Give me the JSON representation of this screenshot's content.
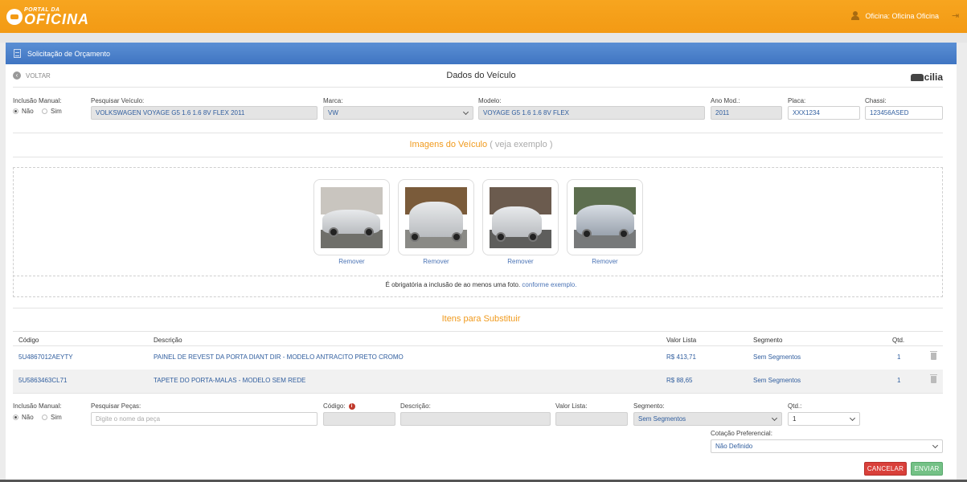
{
  "header": {
    "logo_top": "PORTAL DA",
    "logo_bottom": "OFICINA",
    "user_label": "Oficina: Oficina Oficina"
  },
  "panel": {
    "title": "Solicitação de Orçamento",
    "back_label": "VOLTAR",
    "section_title": "Dados do Veículo",
    "brand_logo": "cilia"
  },
  "vehicle": {
    "manual_label": "Inclusão Manual:",
    "radio_no": "Não",
    "radio_yes": "Sim",
    "search_label": "Pesquisar Veículo:",
    "search_value": "VOLKSWAGEN VOYAGE G5 1.6 1.6 8V FLEX 2011",
    "brand_label": "Marca:",
    "brand_value": "VW",
    "model_label": "Modelo:",
    "model_value": "VOYAGE G5 1.6 1.6 8V FLEX",
    "year_label": "Ano Mod.:",
    "year_value": "2011",
    "plate_label": "Placa:",
    "plate_value": "XXX1234",
    "chassis_label": "Chassi:",
    "chassis_value": "123456ASED"
  },
  "images": {
    "title": "Imagens do Veículo",
    "open_paren": "(",
    "example_link": "veja exemplo",
    "close_paren": ")",
    "remove_label": "Remover",
    "photos": [
      {
        "name": "car-photo-rear-side",
        "remove": "Remover"
      },
      {
        "name": "car-photo-rear",
        "remove": "Remover"
      },
      {
        "name": "car-photo-rear-street",
        "remove": "Remover"
      },
      {
        "name": "car-photo-front-side",
        "remove": "Remover"
      }
    ],
    "note_text": "É obrigatória a inclusão de ao menos uma foto.",
    "note_link": "conforme exemplo."
  },
  "items": {
    "title": "Itens para Substituir",
    "columns": {
      "code": "Código",
      "description": "Descrição",
      "price": "Valor Lista",
      "segment": "Segmento",
      "qty": "Qtd."
    },
    "rows": [
      {
        "code": "5U4867012AEYTY",
        "description": "PAINEL DE REVEST DA PORTA DIANT DIR - MODELO ANTRACITO PRETO CROMO",
        "price": "R$ 413,71",
        "segment": "Sem Segmentos",
        "qty": "1"
      },
      {
        "code": "5U5863463CL71",
        "description": "TAPETE DO PORTA-MALAS - MODELO SEM REDE",
        "price": "R$ 88,65",
        "segment": "Sem Segmentos",
        "qty": "1"
      }
    ]
  },
  "add_part": {
    "manual_label": "Inclusão Manual:",
    "radio_no": "Não",
    "radio_yes": "Sim",
    "search_label": "Pesquisar Peças:",
    "search_placeholder": "Digite o nome da peça",
    "code_label": "Código:",
    "description_label": "Descrição:",
    "price_label": "Valor Lista:",
    "segment_label": "Segmento:",
    "segment_value": "Sem Segmentos",
    "qty_label": "Qtd.:",
    "qty_value": "1",
    "pref_label": "Cotação Preferencial:",
    "pref_value": "Não Definido"
  },
  "actions": {
    "cancel": "CANCELAR",
    "send": "ENVIAR"
  },
  "colors": {
    "header_orange": "#f39a14",
    "panel_blue": "#4a80c8",
    "accent_orange": "#f09a1d",
    "link_blue": "#4a73b5",
    "cancel_red": "#d9403a",
    "send_green": "#74c186"
  }
}
